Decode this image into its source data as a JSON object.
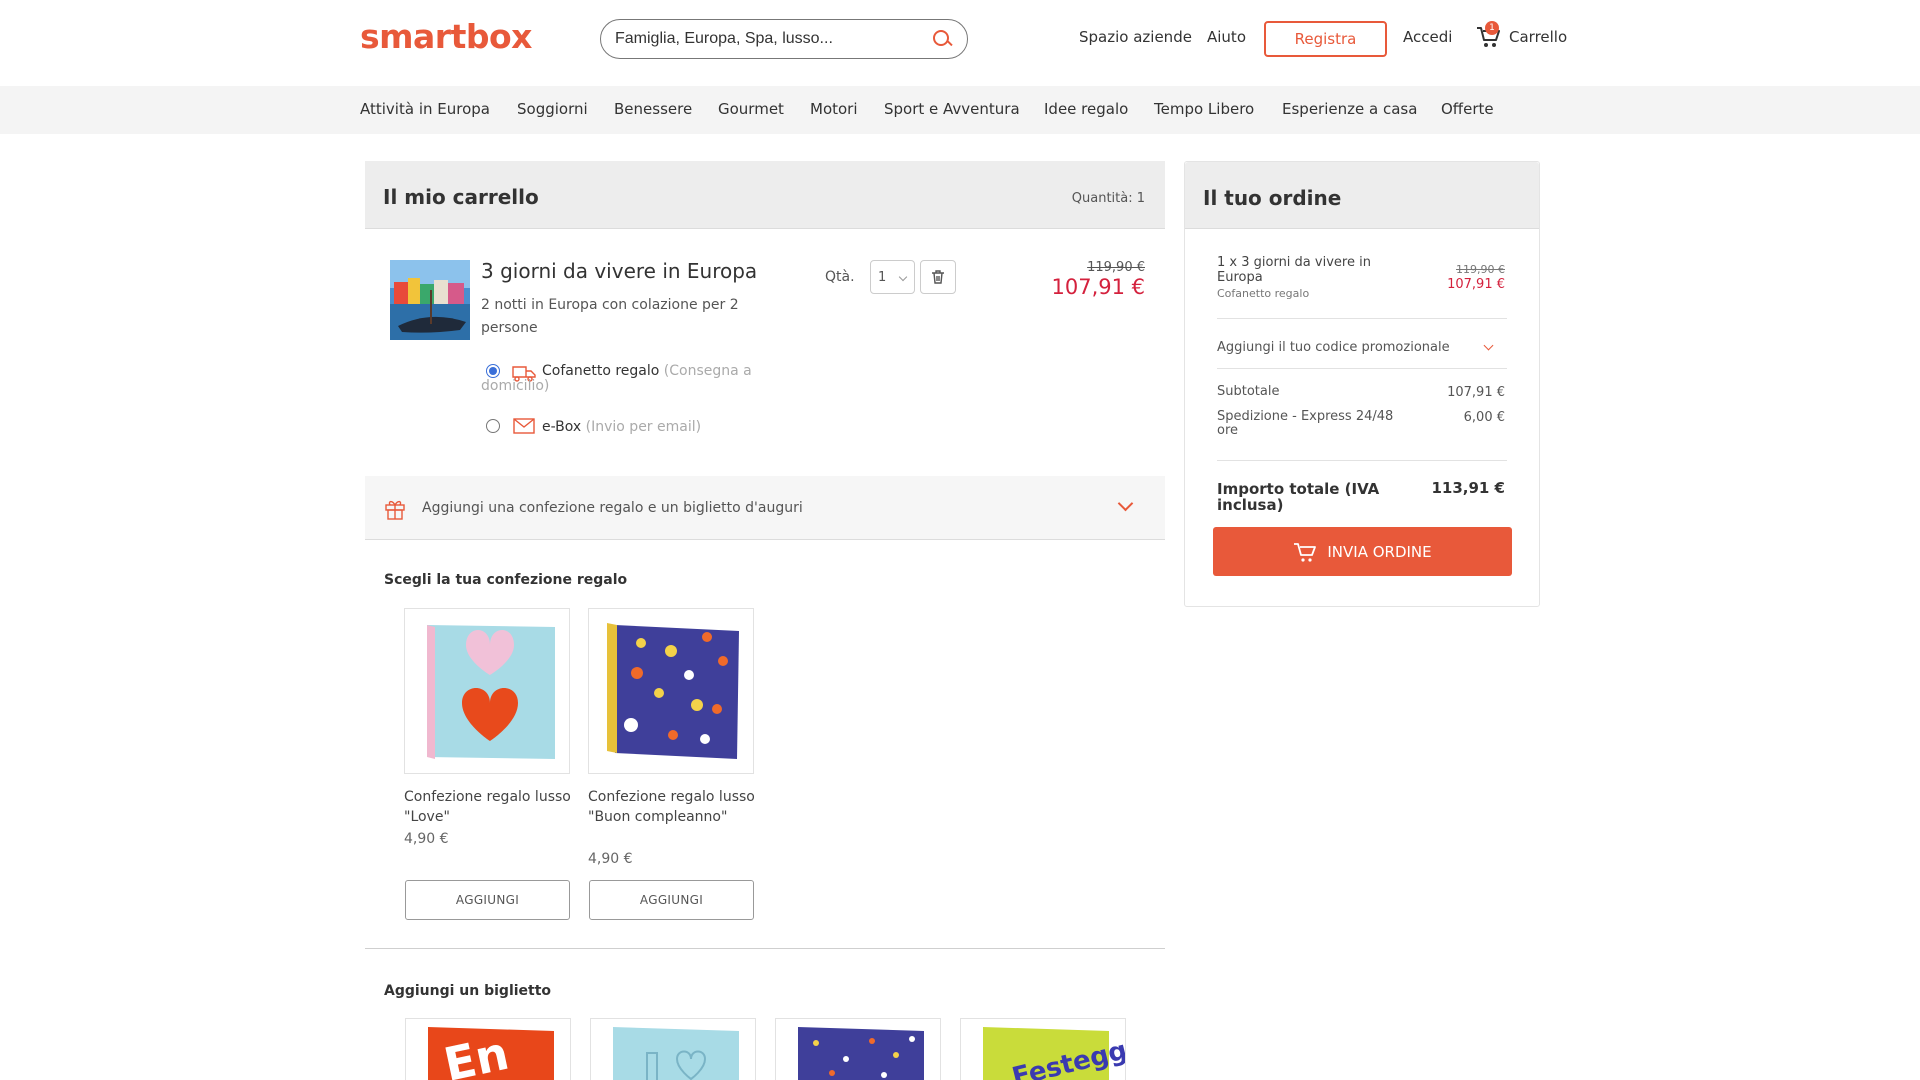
{
  "brand": {
    "logo_text": "smartbox",
    "accent": "#e8593a",
    "price_red": "#d4213d"
  },
  "header": {
    "search_placeholder": "Famiglia, Europa, Spa, lusso...",
    "links": {
      "business": "Spazio aziende",
      "help": "Aiuto",
      "register": "Registra",
      "login": "Accedi",
      "cart": "Carrello"
    },
    "cart_count": "1"
  },
  "nav": [
    "Attività in Europa",
    "Soggiorni",
    "Benessere",
    "Gourmet",
    "Motori",
    "Sport e Avventura",
    "Idee regalo",
    "Tempo Libero",
    "Esperienze a casa",
    "Offerte"
  ],
  "cart": {
    "title": "Il mio carrello",
    "quantity_text": "Quantità: 1",
    "item": {
      "title": "3 giorni da vivere in Europa",
      "description": "2 notti in Europa con colazione per 2 persone",
      "qty_label": "Qtà.",
      "qty_value": "1",
      "old_price": "119,90 €",
      "new_price": "107,91 €"
    },
    "delivery_options": [
      {
        "label": "Cofanetto regalo",
        "note": "(Consegna a domicilio)",
        "selected": true,
        "icon": "truck-icon"
      },
      {
        "label": "e-Box",
        "note": "(Invio per email)",
        "selected": false,
        "icon": "envelope-icon"
      }
    ],
    "gift_accordion": "Aggiungi una confezione regalo e un biglietto d'auguri",
    "gift_section_title": "Scegli la tua confezione regalo",
    "gift_boxes": [
      {
        "name": "Confezione regalo lusso \"Love\"",
        "price": "4,90 €",
        "button": "AGGIUNGI"
      },
      {
        "name": "Confezione regalo lusso \"Buon compleanno\"",
        "price": "4,90 €",
        "button": "AGGIUNGI"
      }
    ],
    "card_section_title": "Aggiungi un biglietto"
  },
  "order": {
    "title": "Il tuo ordine",
    "item_line": "1 x 3 giorni da vivere in Europa",
    "item_type": "Cofanetto regalo",
    "item_old_price": "119,90 €",
    "item_new_price": "107,91 €",
    "promo_label": "Aggiungi il tuo codice promozionale",
    "subtotal_label": "Subtotale",
    "subtotal_value": "107,91 €",
    "shipping_label": "Spedizione - Express 24/48 ore",
    "shipping_value": "6,00 €",
    "total_label": "Importo totale (IVA inclusa)",
    "total_value": "113,91 €",
    "submit_label": "INVIA ORDINE"
  }
}
